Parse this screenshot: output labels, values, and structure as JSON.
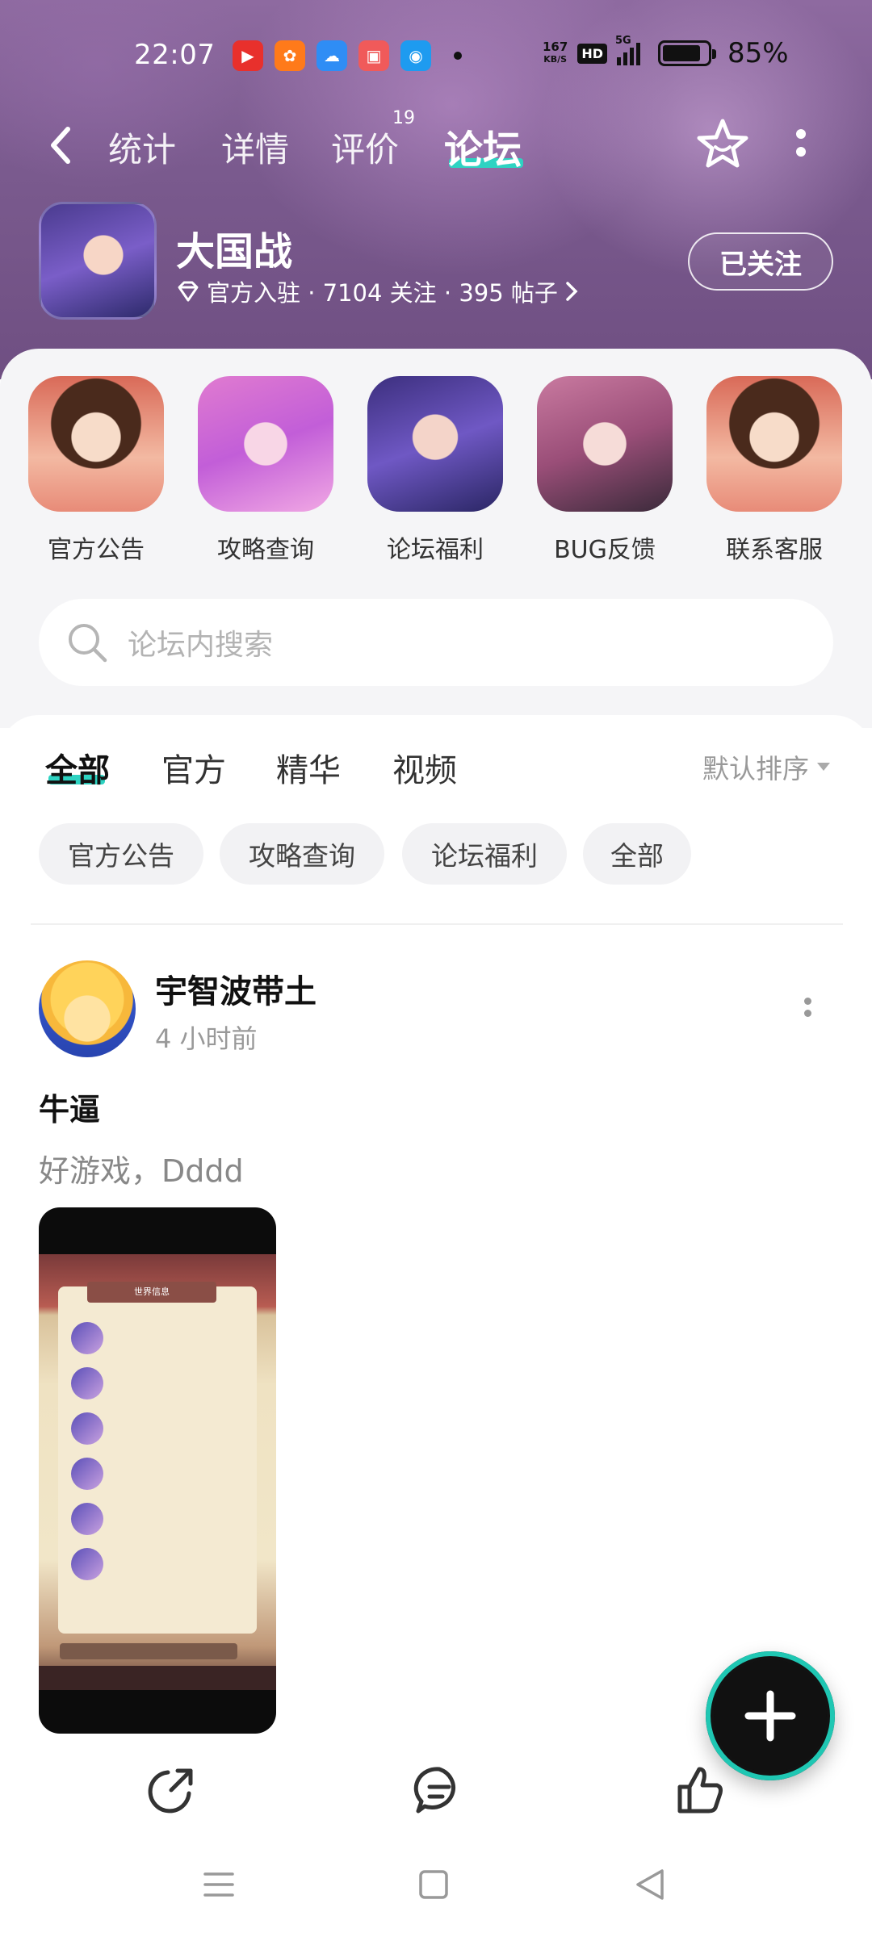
{
  "status_bar": {
    "time": "22:07",
    "net_speed_value": "167",
    "net_speed_unit": "KB/S",
    "hd": "HD",
    "network": "5G",
    "battery_percent": "85%",
    "battery_level": 0.85
  },
  "nav": {
    "tabs": [
      {
        "label": "统计"
      },
      {
        "label": "详情"
      },
      {
        "label": "评价",
        "badge": "19"
      },
      {
        "label": "论坛",
        "active": true
      }
    ]
  },
  "game": {
    "name": "大国战",
    "meta": "官方入驻 · 7104 关注 · 395 帖子",
    "follow_label": "已关注"
  },
  "quick_links": [
    {
      "label": "官方公告"
    },
    {
      "label": "攻略查询"
    },
    {
      "label": "论坛福利"
    },
    {
      "label": "BUG反馈"
    },
    {
      "label": "联系客服"
    }
  ],
  "search": {
    "placeholder": "论坛内搜索"
  },
  "feed": {
    "tabs": [
      {
        "label": "全部",
        "active": true
      },
      {
        "label": "官方"
      },
      {
        "label": "精华"
      },
      {
        "label": "视频"
      }
    ],
    "sort_label": "默认排序",
    "chips": [
      "官方公告",
      "攻略查询",
      "论坛福利",
      "全部"
    ]
  },
  "post": {
    "user": "宇智波带土",
    "time": "4 小时前",
    "title": "牛逼",
    "body": "好游戏，Dddd",
    "image_header": "世界信息"
  },
  "colors": {
    "accent": "#2ed3c2",
    "header_purple": "#7a5a8e"
  }
}
